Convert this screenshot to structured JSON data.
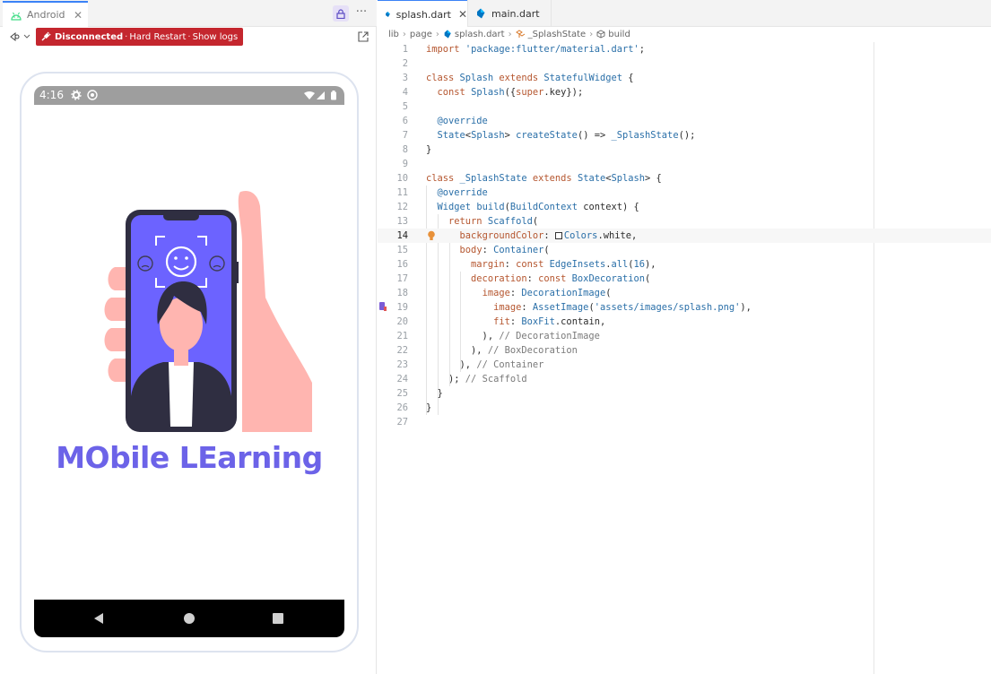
{
  "left_panel": {
    "tab_label": "Android",
    "status": {
      "text": "Disconnected",
      "links": [
        "Hard Restart",
        "Show logs"
      ],
      "separator": "·",
      "color": "#c4262e"
    }
  },
  "device": {
    "status_bar_time": "4:16",
    "splash_title": "MObile LEarning",
    "title_color": "#6c63e8"
  },
  "editor": {
    "tabs": [
      {
        "label": "splash.dart",
        "active": true
      },
      {
        "label": "main.dart",
        "active": false
      }
    ],
    "breadcrumb": [
      "lib",
      "page",
      "splash.dart",
      "_SplashState",
      "build"
    ],
    "current_line": 14,
    "lines": [
      {
        "n": "1",
        "code": "import 'package:flutter/material.dart';"
      },
      {
        "n": "2",
        "code": ""
      },
      {
        "n": "3",
        "code": "class Splash extends StatefulWidget {"
      },
      {
        "n": "4",
        "code": "  const Splash({super.key});"
      },
      {
        "n": "5",
        "code": ""
      },
      {
        "n": "6",
        "code": "  @override"
      },
      {
        "n": "7",
        "code": "  State<Splash> createState() => _SplashState();"
      },
      {
        "n": "8",
        "code": "}"
      },
      {
        "n": "9",
        "code": ""
      },
      {
        "n": "10",
        "code": "class _SplashState extends State<Splash> {"
      },
      {
        "n": "11",
        "code": "  @override"
      },
      {
        "n": "12",
        "code": "  Widget build(BuildContext context) {"
      },
      {
        "n": "13",
        "code": "    return Scaffold("
      },
      {
        "n": "14",
        "code": "      backgroundColor: Colors.white,"
      },
      {
        "n": "15",
        "code": "      body: Container("
      },
      {
        "n": "16",
        "code": "        margin: const EdgeInsets.all(16),"
      },
      {
        "n": "17",
        "code": "        decoration: const BoxDecoration("
      },
      {
        "n": "18",
        "code": "          image: DecorationImage("
      },
      {
        "n": "19",
        "code": "            image: AssetImage('assets/images/splash.png'),"
      },
      {
        "n": "20",
        "code": "            fit: BoxFit.contain,"
      },
      {
        "n": "21",
        "code": "          ), // DecorationImage"
      },
      {
        "n": "22",
        "code": "        ), // BoxDecoration"
      },
      {
        "n": "23",
        "code": "      ), // Container"
      },
      {
        "n": "24",
        "code": "    ); // Scaffold"
      },
      {
        "n": "25",
        "code": "  }"
      },
      {
        "n": "26",
        "code": "}"
      },
      {
        "n": "27",
        "code": ""
      }
    ]
  },
  "icons": [
    "android-icon",
    "lock-icon",
    "more-icon",
    "plug-icon",
    "popout-icon",
    "dart-file-icon",
    "lightbulb-icon",
    "color-swatch-icon",
    "back-nav-icon",
    "home-nav-icon",
    "recents-nav-icon"
  ]
}
